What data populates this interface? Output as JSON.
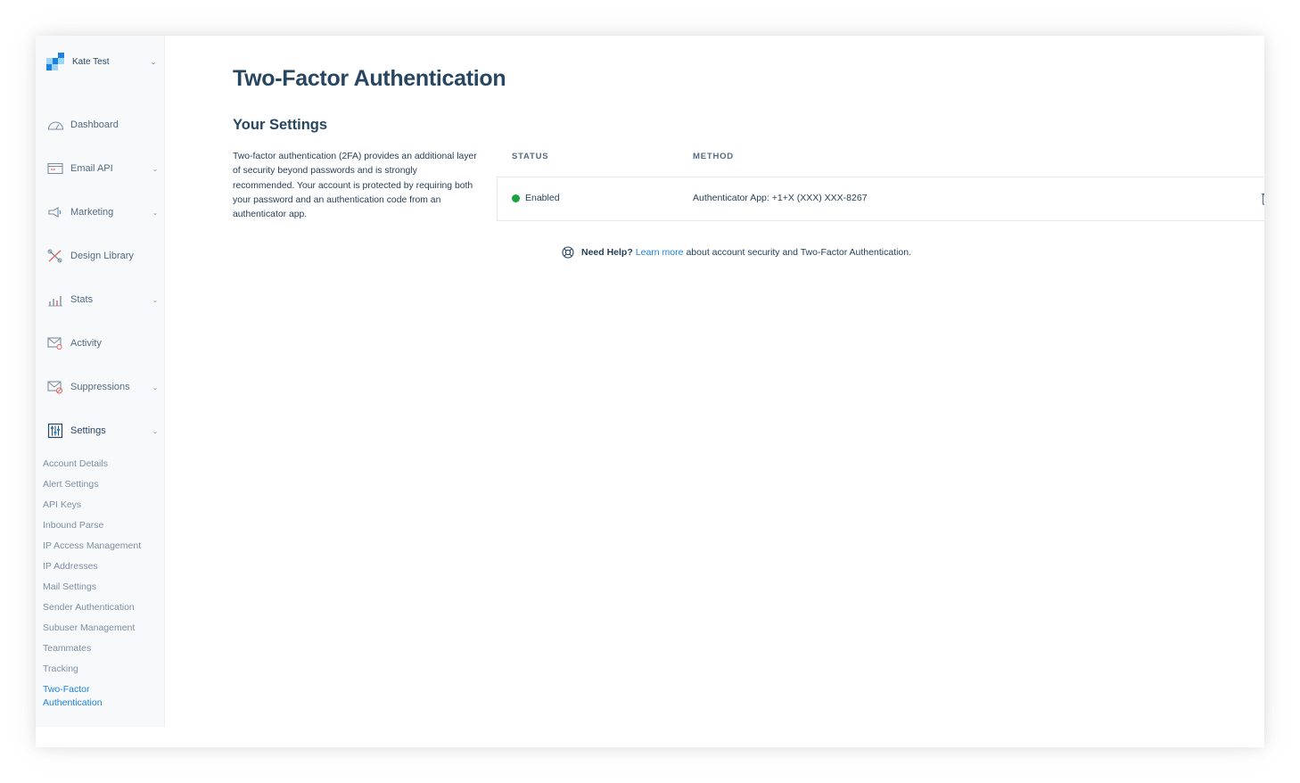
{
  "account": {
    "name": "Kate Test"
  },
  "nav": [
    {
      "label": "Dashboard",
      "icon": "dashboard-icon"
    },
    {
      "label": "Email API",
      "icon": "email-api-icon"
    },
    {
      "label": "Marketing",
      "icon": "megaphone-icon"
    },
    {
      "label": "Design Library",
      "icon": "design-library-icon"
    },
    {
      "label": "Stats",
      "icon": "stats-icon"
    },
    {
      "label": "Activity",
      "icon": "activity-icon"
    },
    {
      "label": "Suppressions",
      "icon": "suppressions-icon"
    },
    {
      "label": "Settings",
      "icon": "settings-icon"
    }
  ],
  "settings_subnav": [
    "Account Details",
    "Alert Settings",
    "API Keys",
    "Inbound Parse",
    "IP Access Management",
    "IP Addresses",
    "Mail Settings",
    "Sender Authentication",
    "Subuser Management",
    "Teammates",
    "Tracking",
    "Two-Factor",
    "Authentication"
  ],
  "page": {
    "title": "Two-Factor Authentication",
    "section_title": "Your Settings",
    "description": "Two-factor authentication (2FA) provides an additional layer of security beyond passwords and is strongly recommended. Your account is protected by requiring both your password and an authentication code from an authenticator app."
  },
  "table": {
    "headers": {
      "status": "STATUS",
      "method": "METHOD"
    },
    "row": {
      "status": "Enabled",
      "method": "Authenticator App: +1+X (XXX) XXX-8267"
    }
  },
  "help": {
    "strong": "Need Help?",
    "link": "Learn more",
    "text": "about account security and Two-Factor Authentication."
  },
  "colors": {
    "brand_navy": "#294661",
    "link_blue": "#1a82e2",
    "status_green": "#18a33c",
    "logo_dark": "#1a82e2",
    "logo_light": "#9dd6f5"
  }
}
